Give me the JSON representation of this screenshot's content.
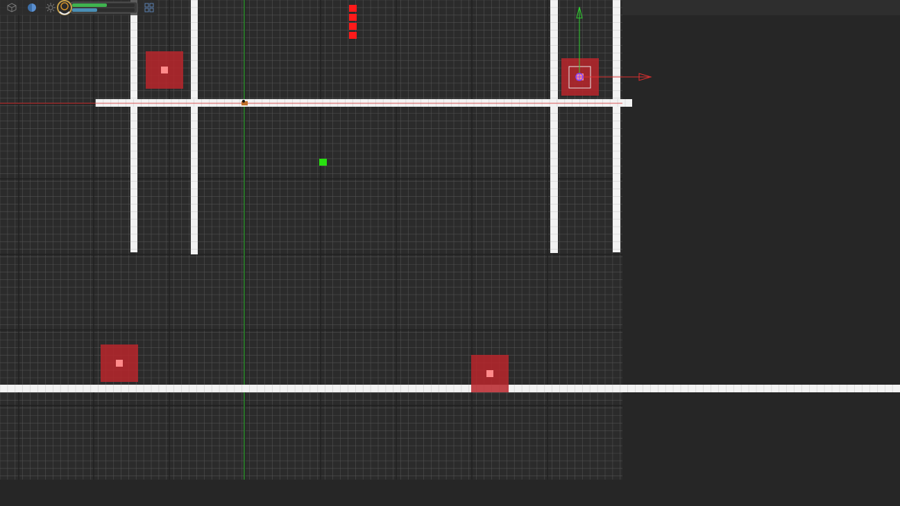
{
  "viewport": {
    "background_color": "#262626",
    "grid_color": "#5a5a5a",
    "grid_major_color": "#6e6e6e",
    "wall_color": "#f2f2f2",
    "x_axis_color": "#d43030",
    "y_axis_color": "#2fbf2f",
    "zone_color": "#b8262b",
    "zone_center_color": "#ff8a8a",
    "marker_green": "#28e010",
    "marker_red": "#ff1a1a"
  },
  "toolbar": {
    "buttons": [
      {
        "name": "cube-view-icon"
      },
      {
        "name": "shading-mode-icon"
      },
      {
        "name": "lighting-icon"
      },
      {
        "name": "stats-icon"
      },
      {
        "name": "grid-toggle-icon"
      }
    ],
    "stats": {
      "bar1_fill": 0.55,
      "bar2_fill": 0.4,
      "bar1_color": "#3fb34f",
      "bar2_color": "#4a8fb5"
    }
  },
  "gizmo": {
    "x_axis_color": "#e03030",
    "y_axis_color": "#30d030",
    "pivot_color": "#8040ff"
  }
}
